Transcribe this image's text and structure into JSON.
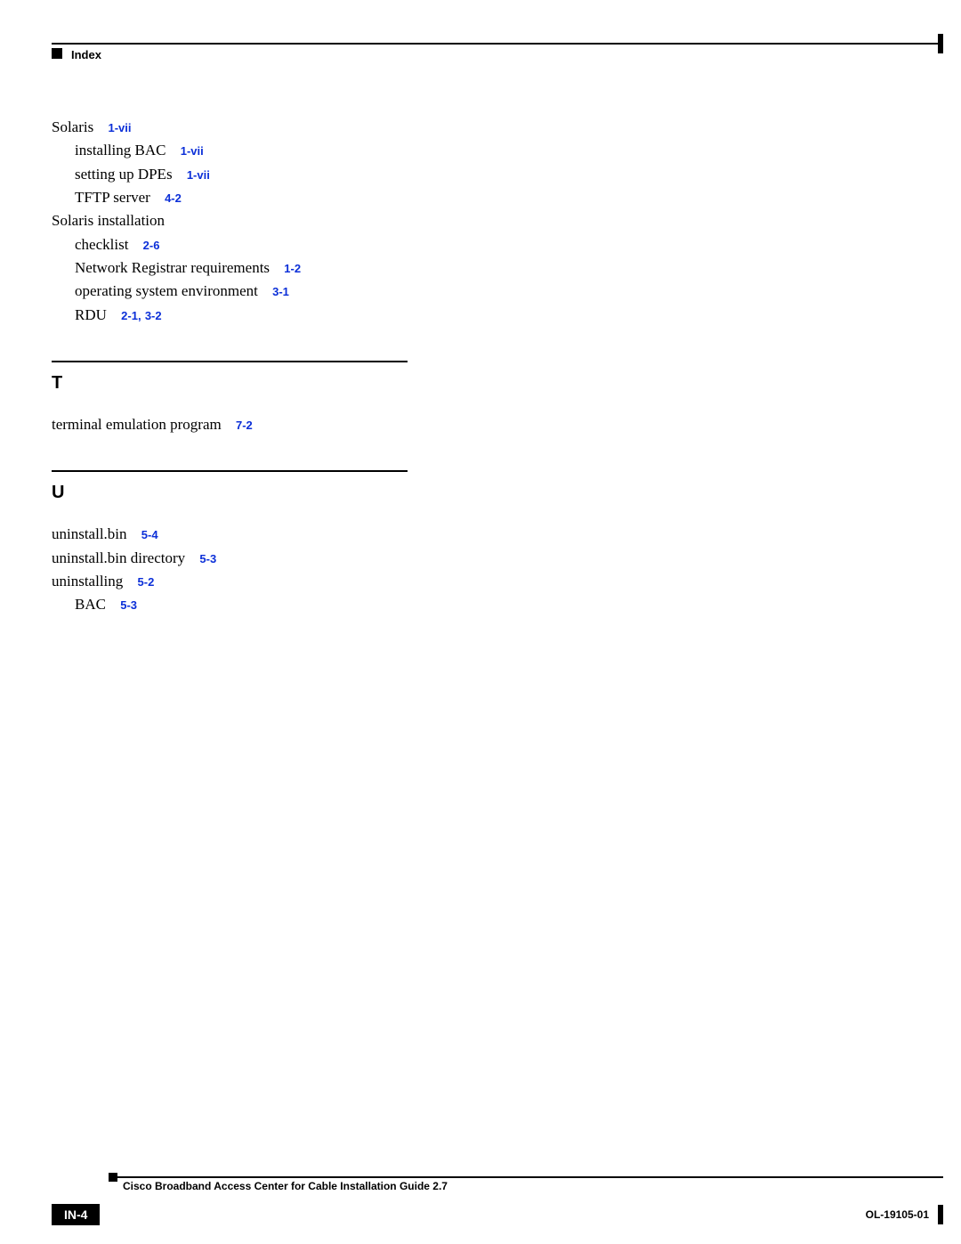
{
  "header": {
    "title": "Index"
  },
  "index": {
    "s": {
      "items": [
        {
          "text": "Solaris",
          "ref": "1-vii",
          "indent": 0
        },
        {
          "text": "installing BAC",
          "ref": "1-vii",
          "indent": 1
        },
        {
          "text": "setting up DPEs",
          "ref": "1-vii",
          "indent": 1
        },
        {
          "text": "TFTP server",
          "ref": "4-2",
          "indent": 1
        },
        {
          "text": "Solaris installation",
          "ref": "",
          "indent": 0
        },
        {
          "text": "checklist",
          "ref": "2-6",
          "indent": 1
        },
        {
          "text": "Network Registrar requirements",
          "ref": "1-2",
          "indent": 1
        },
        {
          "text": "operating system environment",
          "ref": "3-1",
          "indent": 1
        },
        {
          "text": "RDU",
          "ref": "2-1,",
          "ref_extra": "3-2",
          "indent": 1
        }
      ]
    },
    "t": {
      "letter": "T",
      "items": [
        {
          "text": "terminal emulation program",
          "ref": "7-2",
          "indent": 0
        }
      ]
    },
    "u": {
      "letter": "U",
      "items": [
        {
          "text": "uninstall.bin",
          "ref": "5-4",
          "indent": 0
        },
        {
          "text": "uninstall.bin directory",
          "ref": "5-3",
          "indent": 0
        },
        {
          "text": "uninstalling",
          "ref": "5-2",
          "indent": 0
        },
        {
          "text": "BAC",
          "ref": "5-3",
          "indent": 1
        }
      ]
    }
  },
  "footer": {
    "doc_title": "Cisco Broadband Access Center for Cable Installation Guide 2.7",
    "page": "IN-4",
    "code": "OL-19105-01"
  }
}
